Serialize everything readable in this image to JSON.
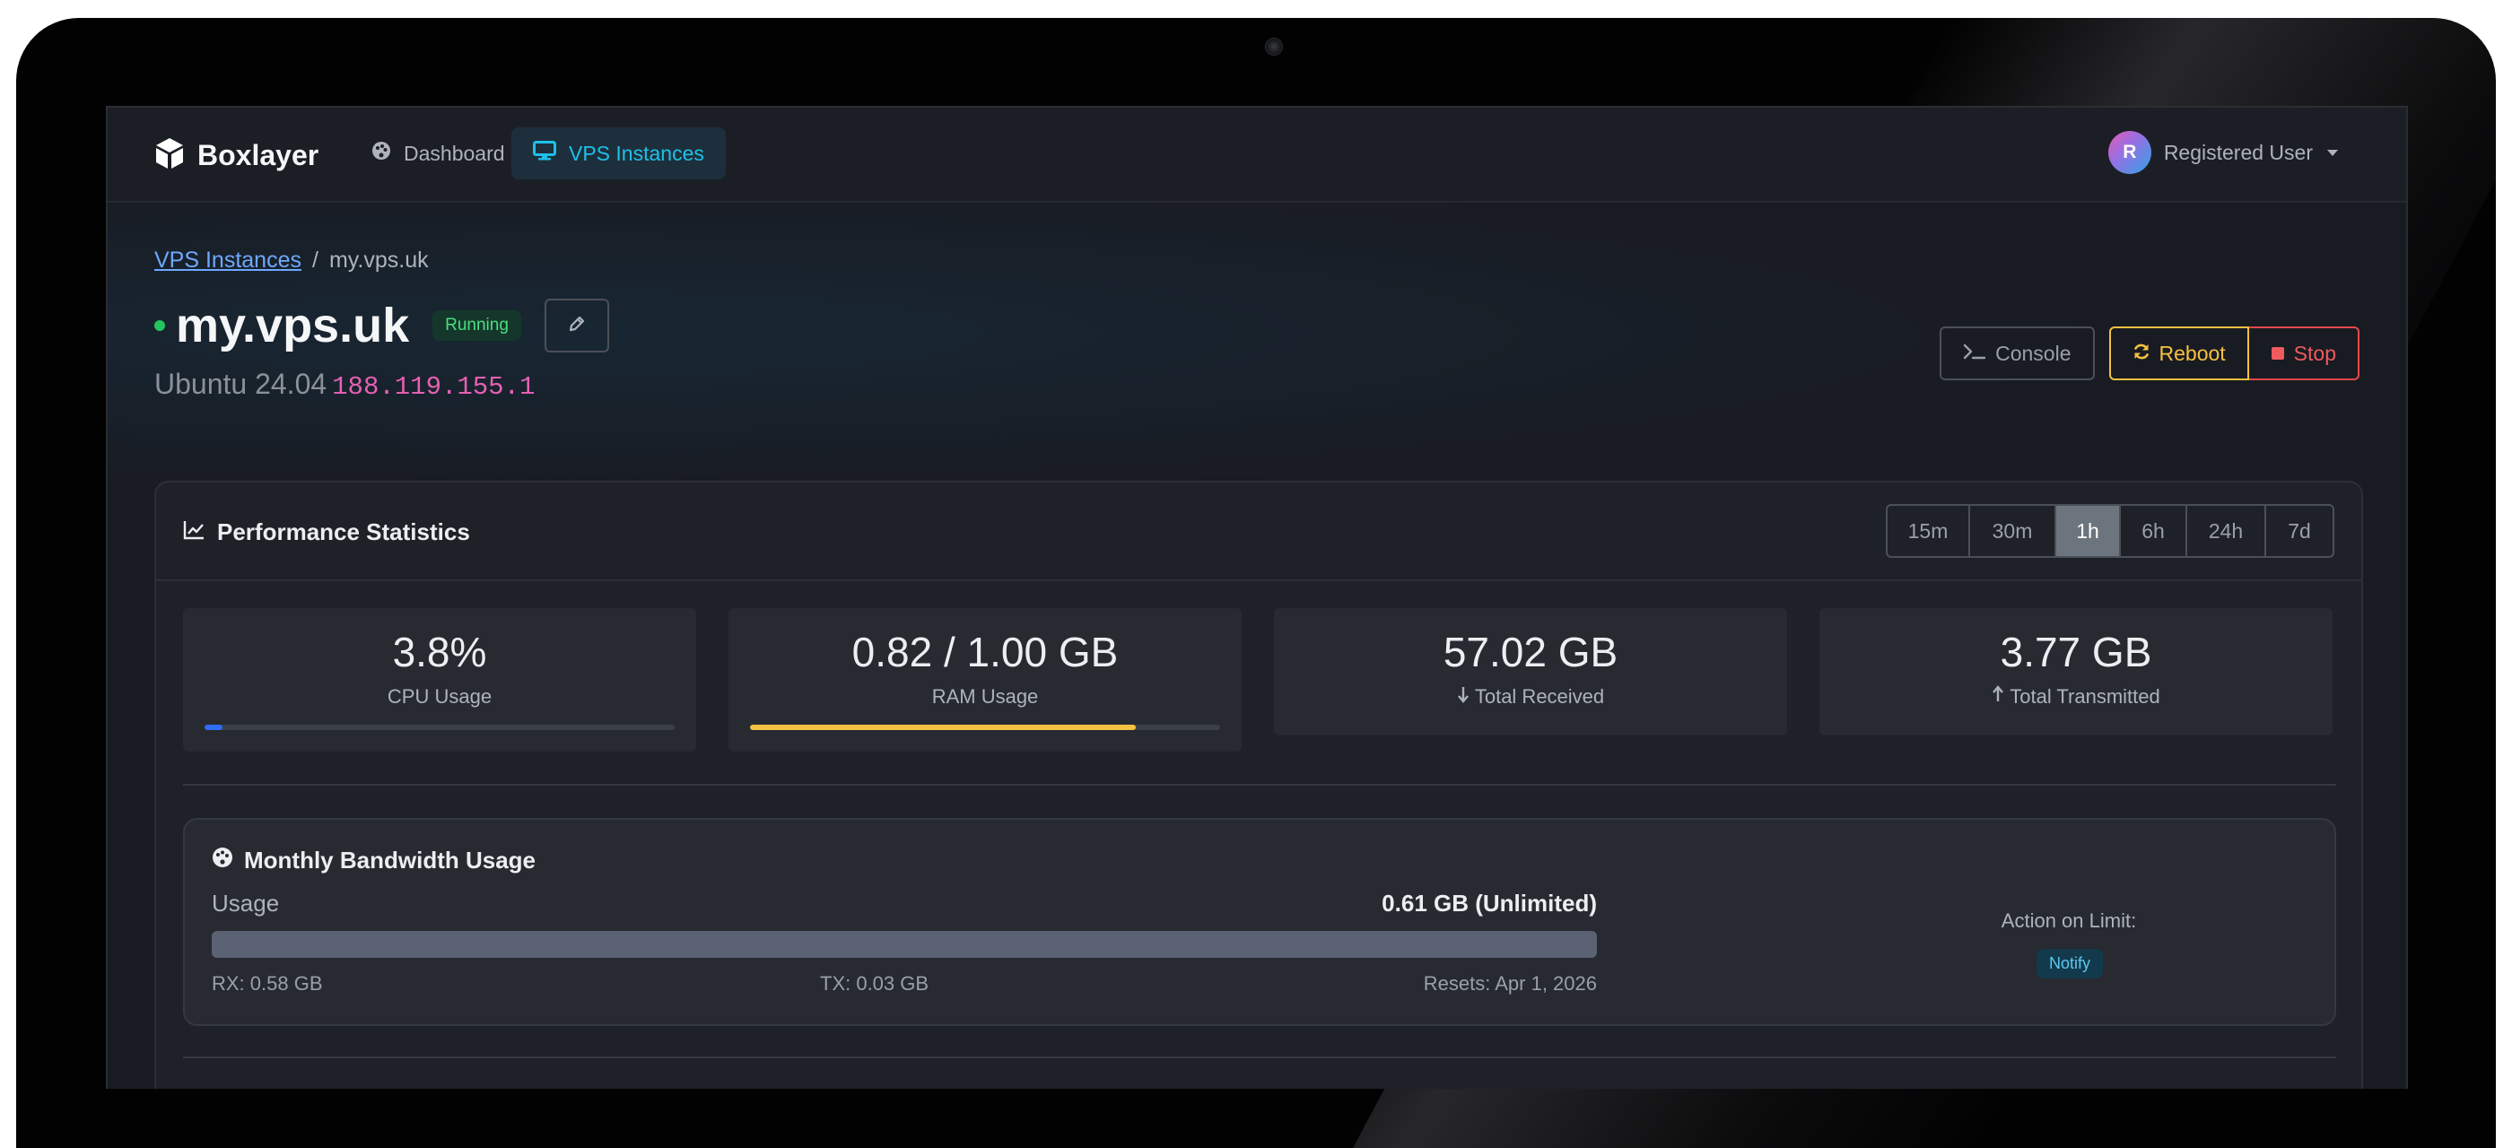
{
  "nav": {
    "brand": "Boxlayer",
    "links": [
      {
        "label": "Dashboard",
        "icon": "palette-icon",
        "active": false
      },
      {
        "label": "VPS Instances",
        "icon": "monitor-icon",
        "active": true
      }
    ],
    "user": {
      "initial": "R",
      "name": "Registered User"
    }
  },
  "breadcrumb": {
    "parent": "VPS Instances",
    "separator": "/",
    "current": "my.vps.uk"
  },
  "instance": {
    "name": "my.vps.uk",
    "status": "Running",
    "os": "Ubuntu 24.04",
    "ip": "188.119.155.1"
  },
  "actions": {
    "console": "Console",
    "reboot": "Reboot",
    "stop": "Stop"
  },
  "performance": {
    "title": "Performance Statistics",
    "ranges": [
      "15m",
      "30m",
      "1h",
      "6h",
      "24h",
      "7d"
    ],
    "active_range": "1h",
    "stats": [
      {
        "value": "3.8%",
        "label": "CPU Usage",
        "progress": 0.038,
        "color": "#2f6df6"
      },
      {
        "value": "0.82 / 1.00 GB",
        "label": "RAM Usage",
        "progress": 0.82,
        "color": "#f6c142"
      },
      {
        "value": "57.02 GB",
        "label": "Total Received"
      },
      {
        "value": "3.77 GB",
        "label": "Total Transmitted"
      }
    ]
  },
  "bandwidth": {
    "title": "Monthly Bandwidth Usage",
    "usage_label": "Usage",
    "usage_value": "0.61 GB (Unlimited)",
    "rx": "RX: 0.58 GB",
    "tx": "TX: 0.03 GB",
    "resets": "Resets: Apr 1, 2026",
    "action_label": "Action on Limit:",
    "action_value": "Notify"
  },
  "colors": {
    "accent": "#1ec0e8",
    "running": "#22c55e",
    "reboot": "#f6c142",
    "stop": "#e5484d",
    "ip": "#e660b3"
  }
}
